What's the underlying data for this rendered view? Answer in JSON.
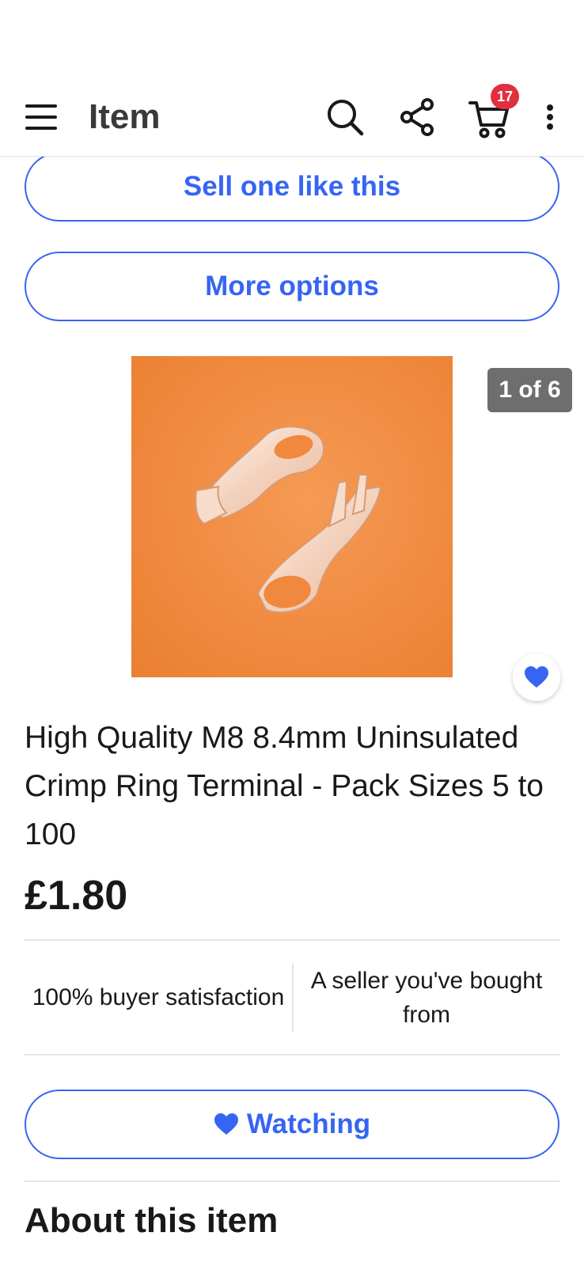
{
  "header": {
    "title": "Item",
    "cart_count": "17"
  },
  "actions": {
    "sell_label": "Sell one like this",
    "more_options_label": "More options"
  },
  "gallery": {
    "counter": "1 of 6"
  },
  "product": {
    "title": "High Quality M8 8.4mm Uninsulated Crimp Ring Terminal - Pack Sizes 5 to 100",
    "price": "£1.80"
  },
  "seller": {
    "satisfaction": "100% buyer satisfaction",
    "relationship": "A seller you've bought from"
  },
  "watch": {
    "label": "Watching"
  },
  "about": {
    "title": "About this item"
  },
  "colors": {
    "accent": "#3665f3",
    "badge": "#e0303e",
    "image_bg": "#f0893e"
  },
  "icons": [
    "menu-icon",
    "search-icon",
    "share-icon",
    "cart-icon",
    "more-vertical-icon",
    "heart-icon"
  ]
}
